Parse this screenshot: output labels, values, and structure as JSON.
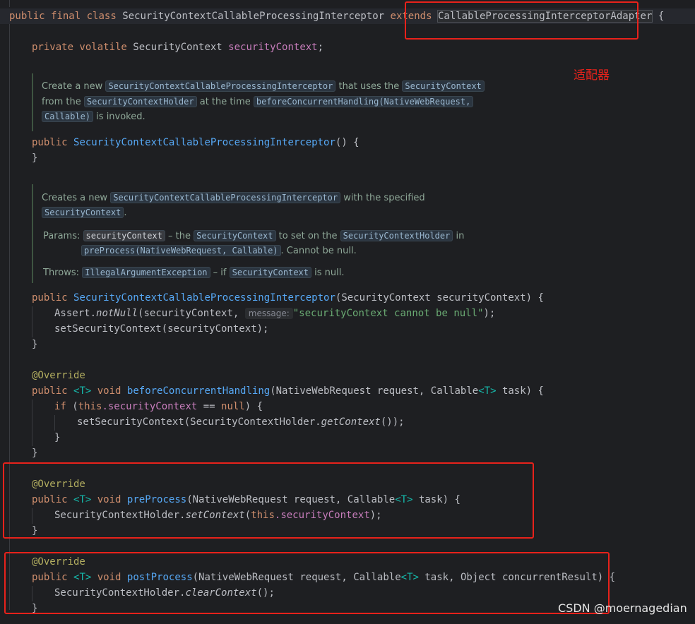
{
  "class_decl": {
    "public": "public",
    "final": "final",
    "class": "class",
    "name": "SecurityContextCallableProcessingInterceptor",
    "extends": "extends",
    "parent": "CallableProcessingInterceptorAdapter",
    "brace": "{"
  },
  "field_decl": {
    "modifiers": "private volatile",
    "type": "SecurityContext",
    "name": "securityContext",
    "end": ";"
  },
  "annotation_note": "适配器",
  "doc1": {
    "t1": "Create a new",
    "c1": "SecurityContextCallableProcessingInterceptor",
    "t2": "that uses the",
    "c2": "SecurityContext",
    "t3": "from the",
    "c3": "SecurityContextHolder",
    "t4": "at the time",
    "c4": "beforeConcurrentHandling(NativeWebRequest,",
    "c5": "Callable)",
    "t5": "is invoked."
  },
  "ctor1": {
    "public": "public",
    "name": "SecurityContextCallableProcessingInterceptor",
    "sig": "() {",
    "close": "}"
  },
  "doc2": {
    "t1": "Creates a new",
    "c1": "SecurityContextCallableProcessingInterceptor",
    "t2": "with the specified",
    "c2": "SecurityContext",
    "t3": ".",
    "params_label": "Params:",
    "p_name": "securityContext",
    "p_t1": "– the",
    "p_c1": "SecurityContext",
    "p_t2": "to set on the",
    "p_c2": "SecurityContextHolder",
    "p_t3": "in",
    "p_c3": "preProcess(NativeWebRequest, Callable)",
    "p_t4": ". Cannot be null.",
    "throws_label": "Throws:",
    "th_c1": "IllegalArgumentException",
    "th_t1": "– if",
    "th_c2": "SecurityContext",
    "th_t2": "is null."
  },
  "ctor2": {
    "public": "public",
    "name": "SecurityContextCallableProcessingInterceptor",
    "params": "(SecurityContext securityContext) {",
    "assert_pre": "Assert.",
    "assert_method": "notNull",
    "assert_args": "(securityContext,",
    "hint": "message:",
    "message": "\"securityContext cannot be null\"",
    "assert_end": ");",
    "set_call": "setSecurityContext(securityContext);",
    "close": "}"
  },
  "m_before": {
    "override": "@Override",
    "public": "public",
    "tparam": "<T>",
    "void": "void",
    "name": "beforeConcurrentHandling",
    "params_a": "(NativeWebRequest request, Callable",
    "params_t": "<T>",
    "params_b": " task) {",
    "if_kw": "if",
    "if_open": " (",
    "this": "this",
    "dot_field": ".securityContext",
    "eq": " == ",
    "null": "null",
    "if_close": ") {",
    "set_pre": "setSecurityContext(SecurityContextHolder.",
    "get_method": "getContext",
    "set_end": "());",
    "inner_close": "}",
    "close": "}"
  },
  "m_pre": {
    "override": "@Override",
    "public": "public",
    "tparam": "<T>",
    "void": "void",
    "name": "preProcess",
    "params_a": "(NativeWebRequest request, Callable",
    "params_t": "<T>",
    "params_b": " task) {",
    "holder": "SecurityContextHolder.",
    "method": "setContext",
    "open": "(",
    "this": "this",
    "field": ".securityContext",
    "end": ");",
    "close": "}"
  },
  "m_post": {
    "override": "@Override",
    "public": "public",
    "tparam": "<T>",
    "void": "void",
    "name": "postProcess",
    "params_a": "(NativeWebRequest request, Callable",
    "params_t": "<T>",
    "params_b": " task, Object concurrentResult) {",
    "holder": "SecurityContextHolder.",
    "method": "clearContext",
    "end": "();",
    "close": "}"
  },
  "watermark": "CSDN @moernagedian",
  "colors": {
    "background": "#1e1f22",
    "keyword": "#cf8e6d",
    "field": "#c77dbb",
    "function": "#56a8f5",
    "annotation": "#b3ae60",
    "type_param": "#16baac",
    "string": "#6aab73",
    "highlight_box": "#e8221b"
  }
}
